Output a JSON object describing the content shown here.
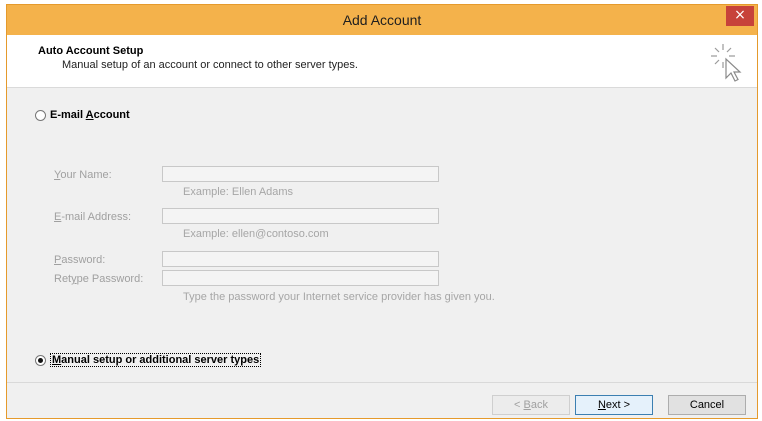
{
  "window": {
    "title": "Add Account",
    "close_symbol": "×"
  },
  "header": {
    "title": "Auto Account Setup",
    "subtitle": "Manual setup of an account or connect to other server types."
  },
  "email_option": {
    "prefix": "E-mail ",
    "accel": "A",
    "suffix": "ccount",
    "selected": false
  },
  "fields": {
    "name": {
      "accel": "Y",
      "rest": "our Name:",
      "value": "",
      "hint": "Example: Ellen Adams"
    },
    "email": {
      "accel": "E",
      "rest": "-mail Address:",
      "value": "",
      "hint": "Example: ellen@contoso.com"
    },
    "password": {
      "accel": "P",
      "rest": "assword:",
      "value": ""
    },
    "retype": {
      "prefix": "Ret",
      "accel": "y",
      "suffix": "pe Password:",
      "value": "",
      "hint": "Type the password your Internet service provider has given you."
    }
  },
  "manual_option": {
    "accel": "M",
    "rest": "anual setup or additional server types",
    "selected": true
  },
  "buttons": {
    "back_prefix": "< ",
    "back_accel": "B",
    "back_rest": "ack",
    "next_accel": "N",
    "next_rest": "ext >",
    "cancel": "Cancel"
  },
  "icons": {
    "close": "close-icon",
    "wizard": "magic-wand-cursor-icon"
  },
  "colors": {
    "titlebar": "#f4b24b",
    "close": "#c7423a",
    "border": "#e59a2c"
  }
}
